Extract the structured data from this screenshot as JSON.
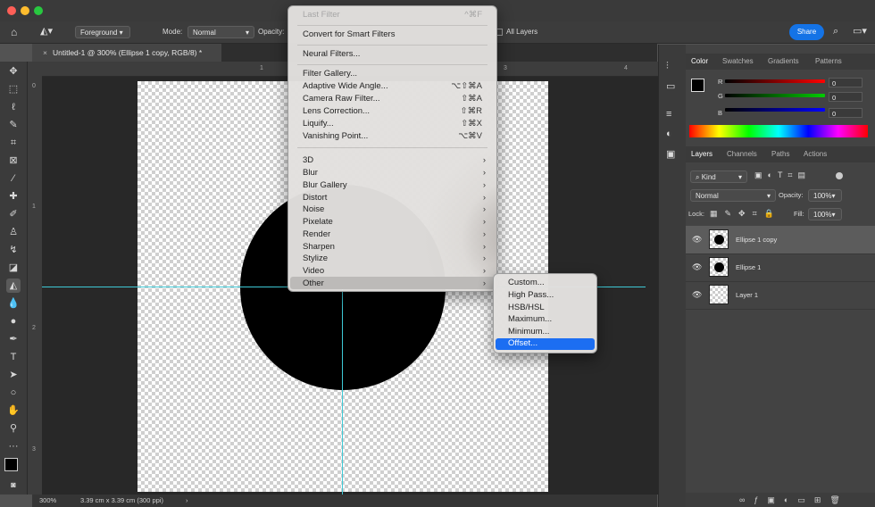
{
  "optionsbar": {
    "fill_source": "Foreground",
    "mode_label": "Mode:",
    "mode_value": "Normal",
    "opacity_label": "Opacity:",
    "all_layers_label": "All Layers",
    "share_label": "Share"
  },
  "document": {
    "tab_title": "Untitled-1 @ 300% (Ellipse 1 copy, RGB/8) *",
    "zoom": "300%",
    "size_info": "3.39 cm x 3.39 cm (300 ppi)"
  },
  "rulers": {
    "top": [
      "1",
      "3",
      "4"
    ],
    "left": [
      "0",
      "1",
      "2",
      "3"
    ]
  },
  "filter_menu": {
    "last_filter": "Last Filter",
    "last_filter_shortcut": "^⌘F",
    "smart": "Convert for Smart Filters",
    "neural": "Neural Filters...",
    "items": [
      {
        "label": "Filter Gallery...",
        "shortcut": ""
      },
      {
        "label": "Adaptive Wide Angle...",
        "shortcut": "⌥⇧⌘A"
      },
      {
        "label": "Camera Raw Filter...",
        "shortcut": "⇧⌘A"
      },
      {
        "label": "Lens Correction...",
        "shortcut": "⇧⌘R"
      },
      {
        "label": "Liquify...",
        "shortcut": "⇧⌘X"
      },
      {
        "label": "Vanishing Point...",
        "shortcut": "⌥⌘V"
      }
    ],
    "groups": [
      "3D",
      "Blur",
      "Blur Gallery",
      "Distort",
      "Noise",
      "Pixelate",
      "Render",
      "Sharpen",
      "Stylize",
      "Video",
      "Other"
    ],
    "highlighted": "Other"
  },
  "other_submenu": {
    "items": [
      "Custom...",
      "High Pass...",
      "HSB/HSL",
      "Maximum...",
      "Minimum...",
      "Offset..."
    ],
    "selected": "Offset..."
  },
  "color_panel": {
    "tabs": [
      "Color",
      "Swatches",
      "Gradients",
      "Patterns"
    ],
    "active_tab": "Color",
    "channels": [
      {
        "label": "R",
        "value": "0",
        "color": "#ff0000"
      },
      {
        "label": "G",
        "value": "0",
        "color": "#00cc00"
      },
      {
        "label": "B",
        "value": "0",
        "color": "#0000ff"
      }
    ]
  },
  "layers_panel": {
    "tabs": [
      "Layers",
      "Channels",
      "Paths",
      "Actions"
    ],
    "active_tab": "Layers",
    "filter_kind": "Kind",
    "blend_mode": "Normal",
    "opacity_label": "Opacity:",
    "opacity_value": "100%",
    "lock_label": "Lock:",
    "fill_label": "Fill:",
    "fill_value": "100%",
    "layers": [
      {
        "name": "Ellipse 1 copy",
        "selected": true,
        "has_dot": true
      },
      {
        "name": "Ellipse 1",
        "selected": false,
        "has_dot": true
      },
      {
        "name": "Layer 1",
        "selected": false,
        "has_dot": false
      }
    ]
  },
  "colors": {
    "guide": "#3ec9d6",
    "accent_blue": "#1473e6",
    "menu_select": "#1c6ef2"
  }
}
